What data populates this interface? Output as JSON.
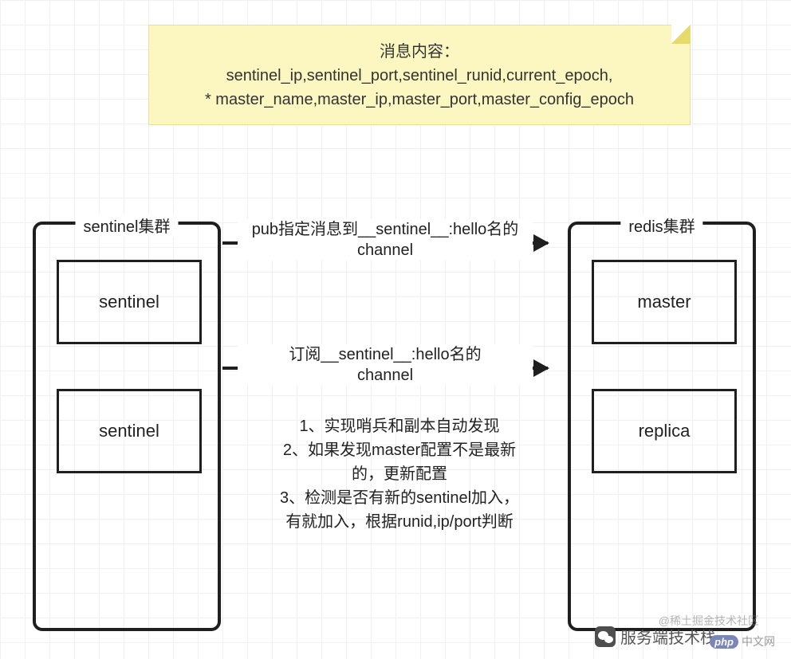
{
  "note": {
    "title": "消息内容：",
    "line1": "sentinel_ip,sentinel_port,sentinel_runid,current_epoch,",
    "line2": "* master_name,master_ip,master_port,master_config_epoch"
  },
  "left_cluster": {
    "title": "sentinel集群",
    "boxes": [
      "sentinel",
      "sentinel"
    ]
  },
  "right_cluster": {
    "title": "redis集群",
    "boxes": [
      "master",
      "replica"
    ]
  },
  "arrows": {
    "a1_line1": "pub指定消息到__sentinel__:hello名的",
    "a1_line2": "channel",
    "a2_line1": "订阅__sentinel__:hello名的",
    "a2_line2": "channel"
  },
  "notes": {
    "n1": "1、实现哨兵和副本自动发现",
    "n2": "2、如果发现master配置不是最新的，更新配置",
    "n3": "3、检测是否有新的sentinel加入，有就加入，根据runid,ip/port判断"
  },
  "watermarks": {
    "brand": "服务端技术栈",
    "community": "@稀土掘金技术社区",
    "site_prefix": "php",
    "site_suffix": "中文网"
  }
}
